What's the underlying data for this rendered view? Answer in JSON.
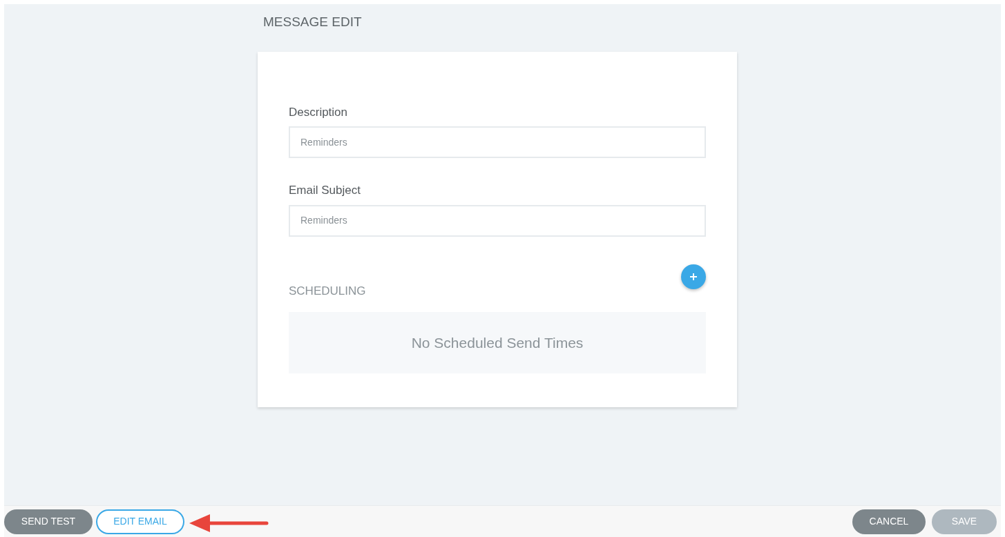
{
  "page_title": "MESSAGE EDIT",
  "fields": [
    {
      "label": "Description",
      "value": "Reminders"
    },
    {
      "label": "Email Subject",
      "value": "Reminders"
    }
  ],
  "scheduling": {
    "heading": "SCHEDULING",
    "empty_text": "No Scheduled Send Times"
  },
  "footer": {
    "left_buttons": [
      {
        "label": "SEND TEST",
        "kind": "filled",
        "disabled": false
      },
      {
        "label": "EDIT EMAIL",
        "kind": "outline",
        "disabled": false
      }
    ],
    "right_buttons": [
      {
        "label": "CANCEL",
        "kind": "filled",
        "disabled": false
      },
      {
        "label": "SAVE",
        "kind": "filled",
        "disabled": true
      }
    ]
  }
}
